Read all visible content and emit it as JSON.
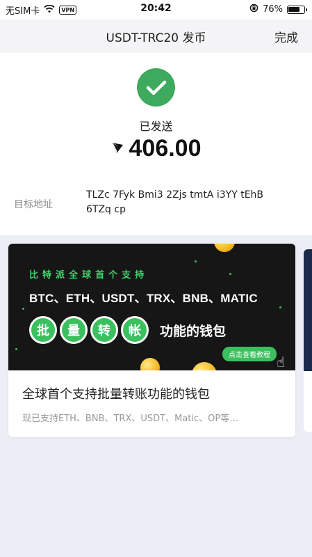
{
  "status_bar": {
    "carrier": "无SIM卡",
    "vpn": "VPN",
    "time": "20:42",
    "battery": "76%",
    "battery_level": 0.76
  },
  "nav": {
    "title": "USDT-TRC20 发币",
    "done": "完成"
  },
  "result": {
    "status": "已发送",
    "amount": "406.00",
    "address_label": "目标地址",
    "address_line1": "TLZc 7Fyk Bmi3 2Zjs tmtA i3YY tEhB",
    "address_line2": "6TZq cp",
    "success_color": "#3daa5e"
  },
  "banner": {
    "slogan_chars": [
      "比",
      "特",
      "派",
      "全",
      "球",
      "首",
      "个",
      "支",
      "持"
    ],
    "coins_line": "BTC、ETH、USDT、TRX、BNB、MATIC",
    "batch_chars": [
      "批",
      "量",
      "转",
      "帐"
    ],
    "batch_suffix": "功能的钱包",
    "cta": "点击查看教程",
    "accent_color": "#3cbf5e"
  },
  "card": {
    "title": "全球首个支持批量转账功能的钱包",
    "description": "现已支持ETH、BNB、TRX、USDT、Matic、OP等…"
  }
}
